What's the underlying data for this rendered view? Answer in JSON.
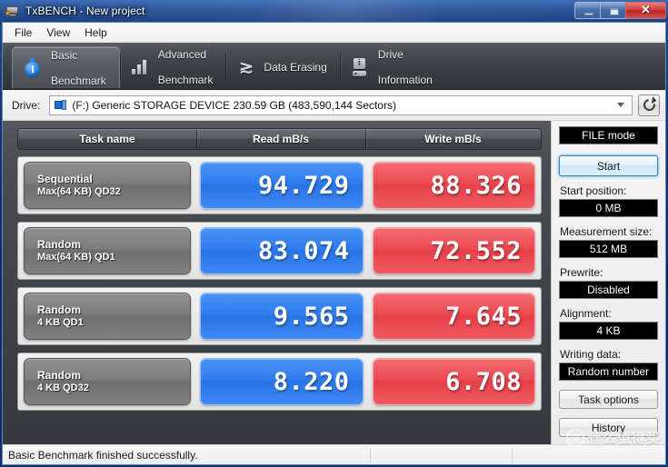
{
  "window": {
    "title": "TxBENCH - New project",
    "icon": "app-icon",
    "controls": {
      "minimize": "–",
      "maximize": "□",
      "close": "✕"
    }
  },
  "menu": {
    "items": [
      {
        "label": "File",
        "accel": "F"
      },
      {
        "label": "View",
        "accel": "V"
      },
      {
        "label": "Help",
        "accel": "H"
      }
    ]
  },
  "tabs": [
    {
      "id": "basic-benchmark",
      "line1": "Basic",
      "line2": "Benchmark",
      "icon": "stopwatch-icon",
      "active": true
    },
    {
      "id": "advanced-benchmark",
      "line1": "Advanced",
      "line2": "Benchmark",
      "icon": "bar-chart-icon",
      "active": false
    },
    {
      "id": "data-erasing",
      "line1": "Data Erasing",
      "line2": "",
      "icon": "shred-icon",
      "active": false
    },
    {
      "id": "drive-information",
      "line1": "Drive",
      "line2": "Information",
      "icon": "drive-info-icon",
      "active": false
    }
  ],
  "drive": {
    "label": "Drive:",
    "accel": "D",
    "selected": "(F:) Generic STORAGE DEVICE  230.59 GB (483,590,144 Sectors)",
    "refresh_icon": "refresh-icon",
    "dropdown_icon": "chevron-down-icon"
  },
  "results": {
    "headers": [
      "Task name",
      "Read mB/s",
      "Write mB/s"
    ],
    "rows": [
      {
        "name_line1": "Sequential",
        "name_line2": "Max(64 KB) QD32",
        "read": "94.729",
        "write": "88.326"
      },
      {
        "name_line1": "Random",
        "name_line2": "Max(64 KB) QD1",
        "read": "83.074",
        "write": "72.552"
      },
      {
        "name_line1": "Random",
        "name_line2": "4 KB QD1",
        "read": "9.565",
        "write": "7.645"
      },
      {
        "name_line1": "Random",
        "name_line2": "4 KB QD32",
        "read": "8.220",
        "write": "6.708"
      }
    ],
    "read_color": "#2f7ef0",
    "write_color": "#ed4a52"
  },
  "sidebar": {
    "mode": "FILE mode",
    "start_button": "Start",
    "fields": [
      {
        "label": "Start position:",
        "value": "0 MB"
      },
      {
        "label": "Measurement size:",
        "value": "512 MB"
      },
      {
        "label": "Prewrite:",
        "value": "Disabled"
      },
      {
        "label": "Alignment:",
        "value": "4 KB"
      },
      {
        "label": "Writing data:",
        "value": "Random number"
      }
    ],
    "buttons": [
      {
        "label": "Task options",
        "accel": "T"
      },
      {
        "label": "History",
        "accel": "s"
      }
    ]
  },
  "statusbar": {
    "message": "Basic Benchmark finished successfully."
  },
  "watermark": {
    "mark": "值",
    "text": "什么值得买"
  }
}
